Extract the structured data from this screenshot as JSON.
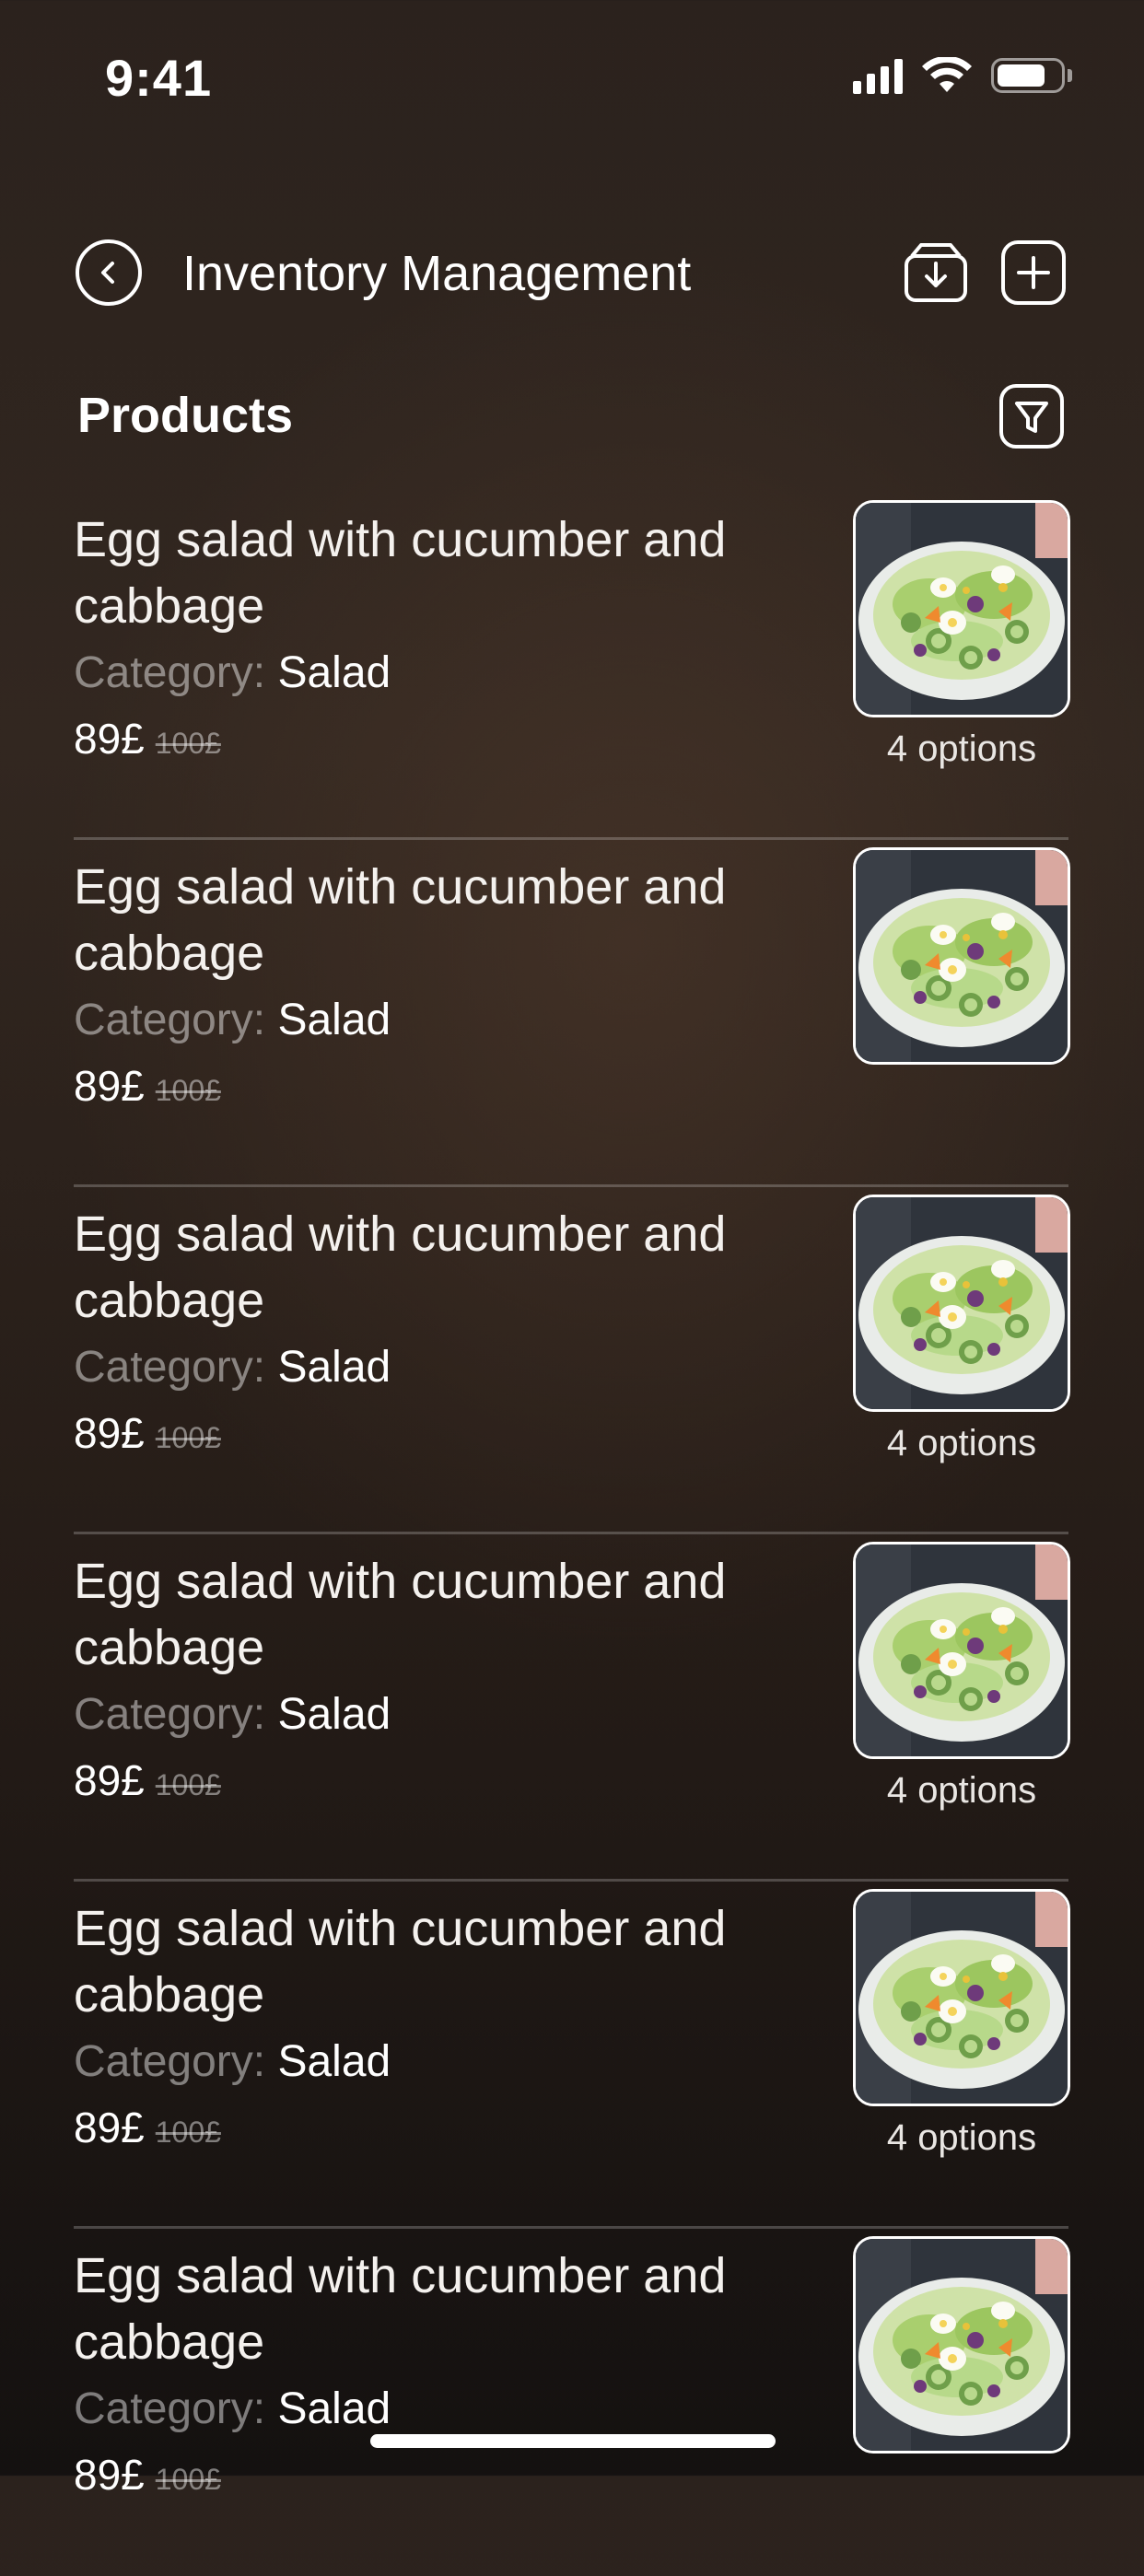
{
  "status_bar": {
    "time": "9:41",
    "icons": [
      "signal-icon",
      "wifi-icon",
      "battery-icon"
    ]
  },
  "header": {
    "title": "Inventory Management",
    "back_icon": "chevron-left-circle-icon",
    "actions": [
      "import-icon",
      "add-icon"
    ]
  },
  "section": {
    "title": "Products",
    "filter_icon": "filter-icon"
  },
  "products": [
    {
      "name": "Egg salad with cucumber and cabbage",
      "category_label": "Category:",
      "category": "Salad",
      "price": "89£",
      "old_price": "100£",
      "options": "4 options"
    },
    {
      "name": "Egg salad with cucumber and cabbage",
      "category_label": "Category:",
      "category": "Salad",
      "price": "89£",
      "old_price": "100£",
      "options": ""
    },
    {
      "name": "Egg salad with cucumber and cabbage",
      "category_label": "Category:",
      "category": "Salad",
      "price": "89£",
      "old_price": "100£",
      "options": "4 options"
    },
    {
      "name": "Egg salad with cucumber and cabbage",
      "category_label": "Category:",
      "category": "Salad",
      "price": "89£",
      "old_price": "100£",
      "options": "4 options"
    },
    {
      "name": "Egg salad with cucumber and cabbage",
      "category_label": "Category:",
      "category": "Salad",
      "price": "89£",
      "old_price": "100£",
      "options": "4 options"
    },
    {
      "name": "Egg salad with cucumber and cabbage",
      "category_label": "Category:",
      "category": "Salad",
      "price": "89£",
      "old_price": "100£",
      "options": ""
    }
  ],
  "colors": {
    "background": "#2b221d",
    "text": "#ffffff",
    "muted": "#8a8480"
  }
}
